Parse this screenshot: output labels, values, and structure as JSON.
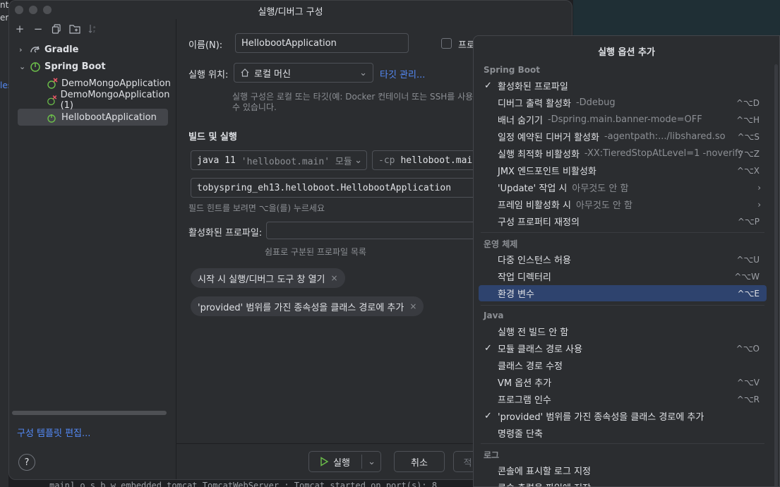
{
  "background": {
    "left_fragments": [
      "nt",
      "er",
      "les"
    ],
    "bottom_log": "main] o.s.b.w.embedded.tomcat.TomcatWebServer  : Tomcat started on port(s): 8"
  },
  "dialog": {
    "title": "실행/디버그 구성",
    "tree": {
      "gradle": "Gradle",
      "spring_boot": "Spring Boot",
      "items": [
        "DemoMongoApplication",
        "DemoMongoApplication (1)",
        "HellobootApplication"
      ]
    },
    "edit_templates": "구성 템플릿 편집...",
    "help": "?",
    "name_label": "이름(N):",
    "name_value": "HellobootApplication",
    "store_checkbox_label": "프로",
    "run_on_label": "실행 위치:",
    "run_on_value": "로컬 머신",
    "manage_targets": "타깃 관리...",
    "run_on_hint_1": "실행 구성은 로컬 또는 타깃(예: Docker 컨테이너 또는 SSH를 사용하",
    "run_on_hint_2": "수 있습니다.",
    "build_run_section": "빌드 및 실행",
    "jre_main": "java 11",
    "jre_module": "'helloboot.main' 모듈",
    "cp_flag": "-cp",
    "cp_value": "helloboot.main",
    "main_class": "tobyspring_eh13.helloboot.HellobootApplication",
    "field_hint": "필드 힌트를 보려면 ⌥을(를) 누르세요",
    "active_profiles_label": "활성화된 프로파일:",
    "active_profiles_value": "",
    "active_profiles_hint": "쉼표로 구분된 프로파일 목록",
    "chips": [
      "시작 시 실행/디버그 도구 창 열기",
      "'provided' 범위를 가진 종속성을 클래스 경로에 추가"
    ],
    "chip_remove": "×",
    "run_button": "실행",
    "cancel_button": "취소",
    "apply_button": "적"
  },
  "popup": {
    "title": "실행 옵션 추가",
    "groups": [
      {
        "name": "Spring Boot",
        "options": [
          {
            "label": "활성화된 프로파일",
            "checked": true,
            "sub": "",
            "shortcut": ""
          },
          {
            "label": "디버그 출력 활성화",
            "checked": false,
            "sub": "-Ddebug",
            "shortcut": "^⌥D"
          },
          {
            "label": "배너 숨기기",
            "checked": false,
            "sub": "-Dspring.main.banner-mode=OFF",
            "shortcut": "^⌥H"
          },
          {
            "label": "일정 예약된 디버거 활성화",
            "checked": false,
            "sub": "-agentpath:.../libshared.so",
            "shortcut": "^⌥S"
          },
          {
            "label": "실행 최적화 비활성화",
            "checked": false,
            "sub": "-XX:TieredStopAtLevel=1 -noverify",
            "shortcut": "^⌥Z"
          },
          {
            "label": "JMX 엔드포인트 비활성화",
            "checked": false,
            "sub": "",
            "shortcut": "^⌥X"
          },
          {
            "label": "'Update' 작업 시",
            "checked": false,
            "sub": "아무것도 안 함",
            "shortcut": "",
            "submenu": true
          },
          {
            "label": "프레임 비활성화 시",
            "checked": false,
            "sub": "아무것도 안 함",
            "shortcut": "",
            "submenu": true
          },
          {
            "label": "구성 프로퍼티 재정의",
            "checked": false,
            "sub": "",
            "shortcut": "^⌥P"
          }
        ]
      },
      {
        "name": "운영 체제",
        "options": [
          {
            "label": "다중 인스턴스 허용",
            "checked": false,
            "sub": "",
            "shortcut": "^⌥U"
          },
          {
            "label": "작업 디렉터리",
            "checked": false,
            "sub": "",
            "shortcut": "^⌥W"
          },
          {
            "label": "환경 변수",
            "checked": false,
            "sub": "",
            "shortcut": "^⌥E",
            "highlighted": true
          }
        ]
      },
      {
        "name": "Java",
        "options": [
          {
            "label": "실행 전 빌드 안 함",
            "checked": false,
            "sub": "",
            "shortcut": ""
          },
          {
            "label": "모듈 클래스 경로 사용",
            "checked": true,
            "sub": "",
            "shortcut": "^⌥O"
          },
          {
            "label": "클래스 경로 수정",
            "checked": false,
            "sub": "",
            "shortcut": ""
          },
          {
            "label": "VM 옵션 추가",
            "checked": false,
            "sub": "",
            "shortcut": "^⌥V"
          },
          {
            "label": "프로그램 인수",
            "checked": false,
            "sub": "",
            "shortcut": "^⌥R"
          },
          {
            "label": "'provided' 범위를 가진 종속성을 클래스 경로에 추가",
            "checked": true,
            "sub": "",
            "shortcut": ""
          },
          {
            "label": "명령줄 단축",
            "checked": false,
            "sub": "",
            "shortcut": ""
          }
        ]
      },
      {
        "name": "로그",
        "options": [
          {
            "label": "콘솔에 표시할 로그 지정",
            "checked": false,
            "sub": "",
            "shortcut": ""
          },
          {
            "label": "콘솔 출력을 파일에 저장",
            "checked": false,
            "sub": "",
            "shortcut": ""
          }
        ]
      }
    ]
  },
  "colors": {
    "accent": "#548af7",
    "highlight": "#2e436e",
    "spring_green": "#6cbf4a"
  }
}
